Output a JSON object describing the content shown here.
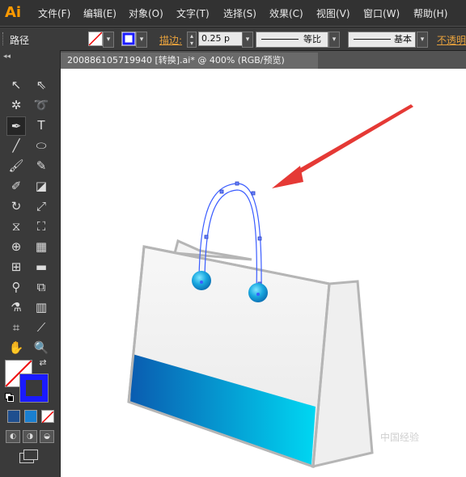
{
  "app": {
    "logo": "Ai"
  },
  "menu": {
    "items": [
      "文件(F)",
      "编辑(E)",
      "对象(O)",
      "文字(T)",
      "选择(S)",
      "效果(C)",
      "视图(V)",
      "窗口(W)",
      "帮助(H)"
    ]
  },
  "control_bar": {
    "selection_type": "路径",
    "stroke_label": "描边:",
    "stroke_weight": "0.25 p",
    "profile_1": "等比",
    "profile_2": "基本",
    "opacity_label": "不透明"
  },
  "document": {
    "tab_title": "20088610571994​0  [转换].ai* @ 400% (RGB/预览)"
  },
  "watermark": "中国经验",
  "colors": {
    "accent": "#ff9a00",
    "stroke_label": "#e8a23d",
    "path_selection": "#3a5cff",
    "arrow": "#e53935",
    "bag_blue_start": "#0a5cb0",
    "bag_blue_end": "#00d7f2"
  }
}
